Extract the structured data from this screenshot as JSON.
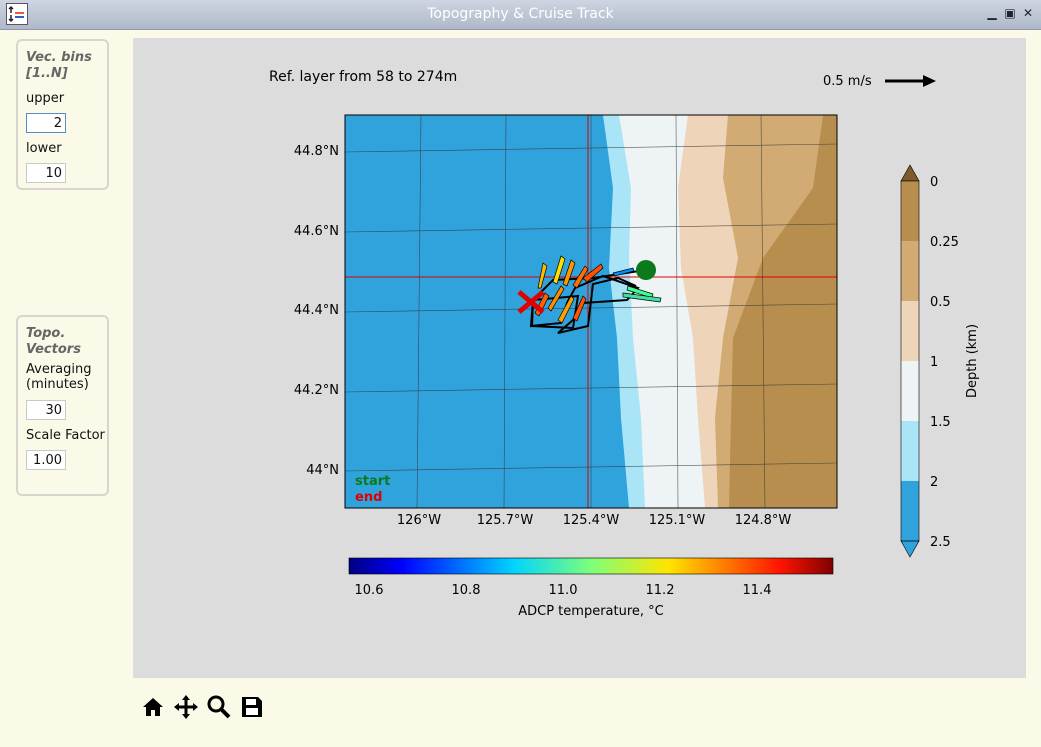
{
  "window": {
    "title": "Topography & Cruise Track"
  },
  "vec_bins": {
    "title": "Vec. bins [1..N]",
    "upper_label": "upper",
    "upper_value": "2",
    "lower_label": "lower",
    "lower_value": "10"
  },
  "topo_vectors": {
    "title": "Topo. Vectors",
    "averaging_label": "Averaging (minutes)",
    "averaging_value": "30",
    "scale_label": "Scale Factor",
    "scale_value": "1.00"
  },
  "figure": {
    "ref_layer_text": "Ref. layer from 58 to 274m",
    "scale_arrow_text": "0.5 m/s",
    "lat_ticks": [
      "44.8°N",
      "44.6°N",
      "44.4°N",
      "44.2°N",
      "44°N"
    ],
    "lon_ticks": [
      "126°W",
      "125.7°W",
      "125.4°W",
      "125.1°W",
      "124.8°W"
    ],
    "legend_start": "start",
    "legend_end": "end",
    "depth_colorbar": {
      "label": "Depth (km)",
      "ticks": [
        "0",
        "0.25",
        "0.5",
        "1",
        "1.5",
        "2",
        "2.5"
      ],
      "colors": [
        "#b78e4e",
        "#d1ab73",
        "#eed4b8",
        "#eef3f5",
        "#a9e5f7",
        "#30a3dc"
      ]
    },
    "temp_colorbar": {
      "label": "ADCP temperature, °C",
      "ticks": [
        "10.6",
        "10.8",
        "11.0",
        "11.2",
        "11.4"
      ]
    }
  },
  "colors": {
    "start": "#0a7a1a",
    "end": "#e00000",
    "crosshair": "#e00000"
  }
}
